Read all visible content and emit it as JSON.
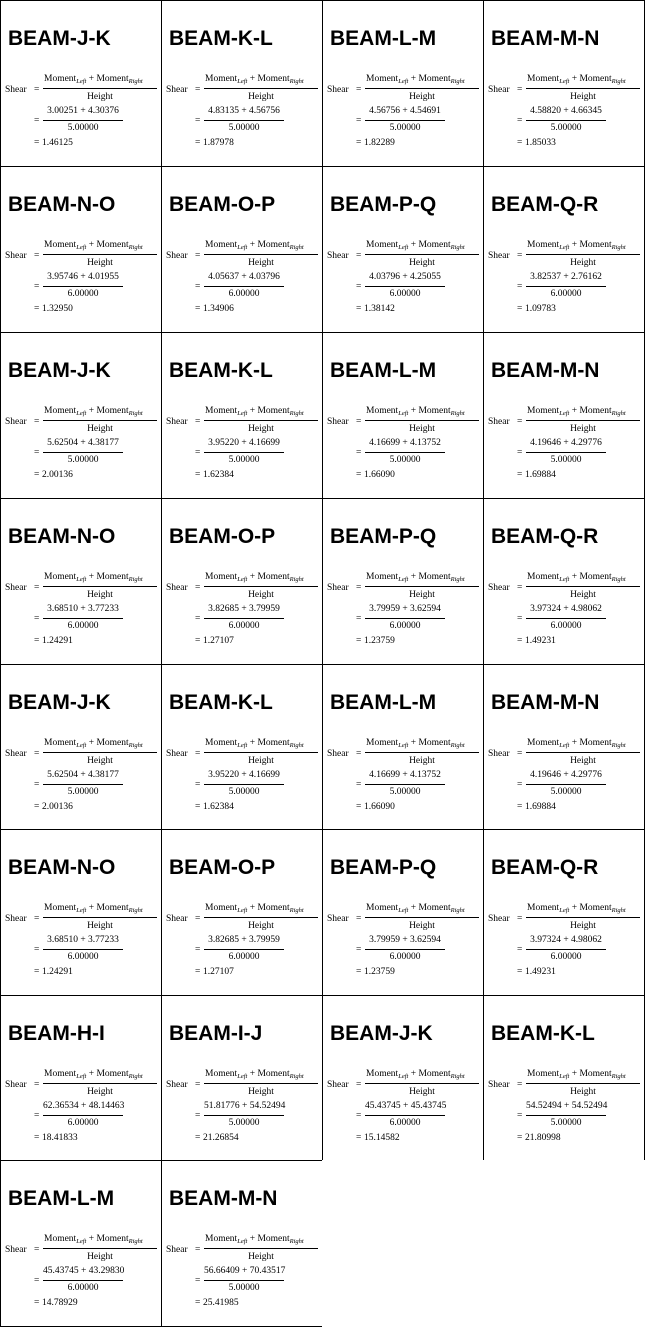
{
  "labels": {
    "shear": "Shear",
    "equals": "=",
    "moment": "Moment",
    "left_sub": "Left",
    "right_sub": "Right",
    "plus": " + ",
    "height": "Height",
    "result_prefix": "= "
  },
  "cells": [
    {
      "title": "BEAM-J-K",
      "expr": "3.00251 + 4.30376",
      "height": "5.00000",
      "result": "1.46125"
    },
    {
      "title": "BEAM-K-L",
      "expr": "4.83135 + 4.56756",
      "height": "5.00000",
      "result": "1.87978"
    },
    {
      "title": "BEAM-L-M",
      "expr": "4.56756 + 4.54691",
      "height": "5.00000",
      "result": "1.82289"
    },
    {
      "title": "BEAM-M-N",
      "expr": "4.58820 + 4.66345",
      "height": "5.00000",
      "result": "1.85033"
    },
    {
      "title": "BEAM-N-O",
      "expr": "3.95746 + 4.01955",
      "height": "6.00000",
      "result": "1.32950"
    },
    {
      "title": "BEAM-O-P",
      "expr": "4.05637 + 4.03796",
      "height": "6.00000",
      "result": "1.34906"
    },
    {
      "title": "BEAM-P-Q",
      "expr": "4.03796 + 4.25055",
      "height": "6.00000",
      "result": "1.38142"
    },
    {
      "title": "BEAM-Q-R",
      "expr": "3.82537 + 2.76162",
      "height": "6.00000",
      "result": "1.09783"
    },
    {
      "title": "BEAM-J-K",
      "expr": "5.62504 + 4.38177",
      "height": "5.00000",
      "result": "2.00136"
    },
    {
      "title": "BEAM-K-L",
      "expr": "3.95220 + 4.16699",
      "height": "5.00000",
      "result": "1.62384"
    },
    {
      "title": "BEAM-L-M",
      "expr": "4.16699 + 4.13752",
      "height": "5.00000",
      "result": "1.66090"
    },
    {
      "title": "BEAM-M-N",
      "expr": "4.19646 + 4.29776",
      "height": "5.00000",
      "result": "1.69884"
    },
    {
      "title": "BEAM-N-O",
      "expr": "3.68510 + 3.77233",
      "height": "6.00000",
      "result": "1.24291"
    },
    {
      "title": "BEAM-O-P",
      "expr": "3.82685 + 3.79959",
      "height": "6.00000",
      "result": "1.27107"
    },
    {
      "title": "BEAM-P-Q",
      "expr": "3.79959 + 3.62594",
      "height": "6.00000",
      "result": "1.23759"
    },
    {
      "title": "BEAM-Q-R",
      "expr": "3.97324 + 4.98062",
      "height": "6.00000",
      "result": "1.49231"
    },
    {
      "title": "BEAM-J-K",
      "expr": "5.62504 + 4.38177",
      "height": "5.00000",
      "result": "2.00136"
    },
    {
      "title": "BEAM-K-L",
      "expr": "3.95220 + 4.16699",
      "height": "5.00000",
      "result": "1.62384"
    },
    {
      "title": "BEAM-L-M",
      "expr": "4.16699 + 4.13752",
      "height": "5.00000",
      "result": "1.66090"
    },
    {
      "title": "BEAM-M-N",
      "expr": "4.19646 + 4.29776",
      "height": "5.00000",
      "result": "1.69884"
    },
    {
      "title": "BEAM-N-O",
      "expr": "3.68510 + 3.77233",
      "height": "6.00000",
      "result": "1.24291"
    },
    {
      "title": "BEAM-O-P",
      "expr": "3.82685 + 3.79959",
      "height": "6.00000",
      "result": "1.27107"
    },
    {
      "title": "BEAM-P-Q",
      "expr": "3.79959 + 3.62594",
      "height": "6.00000",
      "result": "1.23759"
    },
    {
      "title": "BEAM-Q-R",
      "expr": "3.97324 + 4.98062",
      "height": "6.00000",
      "result": "1.49231"
    },
    {
      "title": "BEAM-H-I",
      "expr": "62.36534 + 48.14463",
      "height": "6.00000",
      "result": "18.41833"
    },
    {
      "title": "BEAM-I-J",
      "expr": "51.81776 + 54.52494",
      "height": "5.00000",
      "result": "21.26854"
    },
    {
      "title": "BEAM-J-K",
      "expr": "45.43745 + 45.43745",
      "height": "6.00000",
      "result": "15.14582"
    },
    {
      "title": "BEAM-K-L",
      "expr": "54.52494 + 54.52494",
      "height": "5.00000",
      "result": "21.80998"
    },
    {
      "title": "BEAM-L-M",
      "expr": "45.43745 + 43.29830",
      "height": "6.00000",
      "result": "14.78929"
    },
    {
      "title": "BEAM-M-N",
      "expr": "56.66409 + 70.43517",
      "height": "5.00000",
      "result": "25.41985"
    }
  ]
}
